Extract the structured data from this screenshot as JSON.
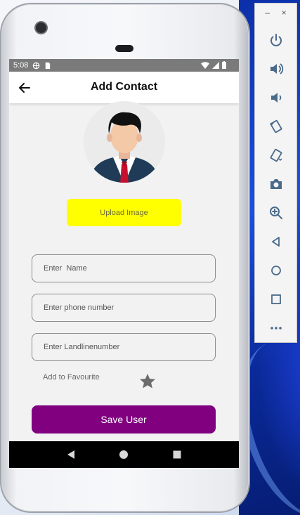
{
  "status_bar": {
    "time": "5:08"
  },
  "app_bar": {
    "title": "Add Contact"
  },
  "upload": {
    "label": "Upload Image"
  },
  "form": {
    "name_placeholder": "Enter  Name",
    "phone_placeholder": "Enter phone number",
    "landline_placeholder": "Enter Landlinenumber"
  },
  "favourite": {
    "label": "Add to Favourite"
  },
  "save": {
    "label": "Save User"
  },
  "colors": {
    "upload_button": "#ffff00",
    "save_button": "#800080",
    "star": "#6b6b6b",
    "status_bar": "#7a7a7a"
  },
  "emulator_toolbar": {
    "window_controls": [
      "minimize-icon",
      "close-icon"
    ],
    "items": [
      "power-icon",
      "volume-up-icon",
      "volume-down-icon",
      "rotate-left-icon",
      "rotate-right-icon",
      "camera-icon",
      "zoom-icon",
      "back-icon",
      "home-icon",
      "overview-icon",
      "more-icon"
    ],
    "minimize_glyph": "–",
    "close_glyph": "×"
  }
}
